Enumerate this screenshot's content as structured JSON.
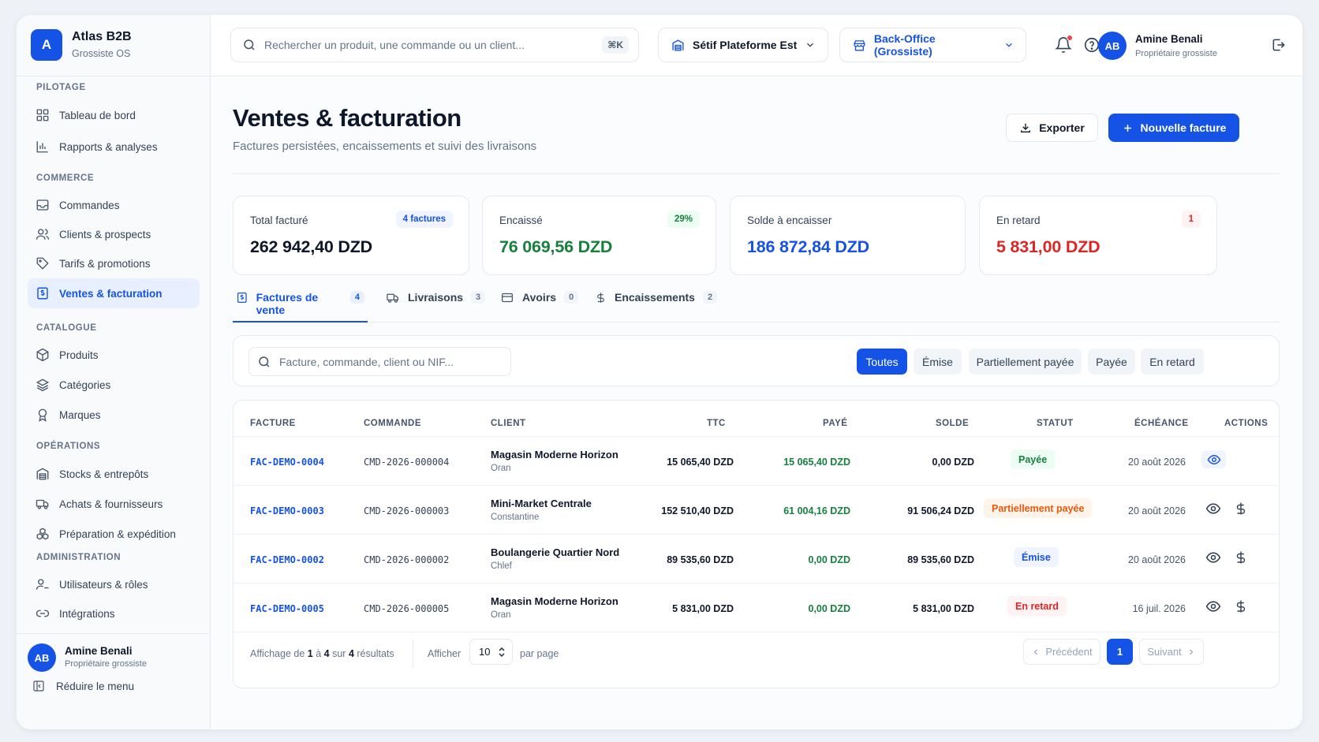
{
  "brand": {
    "logo_letter": "A",
    "name": "Atlas B2B",
    "subtitle": "Grossiste OS"
  },
  "sidebar": {
    "sections": {
      "pilotage": "PILOTAGE",
      "commerce": "COMMERCE",
      "catalogue": "CATALOGUE",
      "operations": "OPÉRATIONS",
      "administration": "ADMINISTRATION"
    },
    "items": [
      {
        "label": "Tableau de bord",
        "icon": "grid-icon"
      },
      {
        "label": "Rapports & analyses",
        "icon": "bar-chart-icon"
      },
      {
        "label": "Commandes",
        "icon": "inbox-icon"
      },
      {
        "label": "Clients & prospects",
        "icon": "users-icon"
      },
      {
        "label": "Tarifs & promotions",
        "icon": "tag-icon"
      },
      {
        "label": "Ventes & facturation",
        "icon": "receipt-icon",
        "active": true
      },
      {
        "label": "Produits",
        "icon": "box-icon"
      },
      {
        "label": "Catégories",
        "icon": "layers-icon"
      },
      {
        "label": "Marques",
        "icon": "award-icon"
      },
      {
        "label": "Stocks & entrepôts",
        "icon": "warehouse-icon"
      },
      {
        "label": "Achats & fournisseurs",
        "icon": "truck-icon"
      },
      {
        "label": "Préparation & expédition",
        "icon": "boxes-icon"
      },
      {
        "label": "Utilisateurs & rôles",
        "icon": "user-cog-icon"
      },
      {
        "label": "Intégrations",
        "icon": "link-icon"
      }
    ],
    "user": {
      "initials": "AB",
      "name": "Amine Benali",
      "role": "Propriétaire grossiste"
    },
    "collapse_label": "Réduire le menu"
  },
  "header": {
    "search_placeholder": "Rechercher un produit, une commande ou un client...",
    "search_shortcut": "⌘K",
    "site": "Sétif Plateforme Est",
    "mode": "Back-Office (Grossiste)",
    "user": {
      "initials": "AB",
      "name": "Amine Benali",
      "role": "Propriétaire grossiste"
    }
  },
  "page": {
    "title": "Ventes & facturation",
    "subtitle": "Factures persistées, encaissements et suivi des livraisons",
    "export_label": "Exporter",
    "new_invoice_label": "Nouvelle facture"
  },
  "kpis": [
    {
      "label": "Total facturé",
      "value": "262 942,40 DZD",
      "badge": "4 factures",
      "value_color": "#0f172a"
    },
    {
      "label": "Encaissé",
      "value": "76 069,56 DZD",
      "badge": "29%",
      "value_color": "#16803c"
    },
    {
      "label": "Solde à encaisser",
      "value": "186 872,84 DZD",
      "badge": "",
      "value_color": "#1553e6"
    },
    {
      "label": "En retard",
      "value": "5 831,00 DZD",
      "badge": "1",
      "value_color": "#dc2626"
    }
  ],
  "tabs": [
    {
      "label": "Factures de vente",
      "count": "4",
      "active": true
    },
    {
      "label": "Livraisons",
      "count": "3"
    },
    {
      "label": "Avoirs",
      "count": "0"
    },
    {
      "label": "Encaissements",
      "count": "2"
    }
  ],
  "filters": {
    "search_placeholder": "Facture, commande, client ou NIF...",
    "chips": [
      "Toutes",
      "Émise",
      "Partiellement payée",
      "Payée",
      "En retard"
    ],
    "active_chip": "Toutes"
  },
  "table": {
    "columns": [
      "FACTURE",
      "COMMANDE",
      "CLIENT",
      "TTC",
      "PAYÉ",
      "SOLDE",
      "STATUT",
      "ÉCHÉANCE",
      "ACTIONS"
    ],
    "rows": [
      {
        "invoice": "FAC-DEMO-0004",
        "order": "CMD-2026-000004",
        "client": "Magasin Moderne Horizon",
        "city": "Oran",
        "ttc": "15 065,40 DZD",
        "paid": "15 065,40 DZD",
        "balance": "0,00 DZD",
        "status": "Payée",
        "due": "20 août 2026"
      },
      {
        "invoice": "FAC-DEMO-0003",
        "order": "CMD-2026-000003",
        "client": "Mini-Market Centrale",
        "city": "Constantine",
        "ttc": "152 510,40 DZD",
        "paid": "61 004,16 DZD",
        "balance": "91 506,24 DZD",
        "status": "Partiellement payée",
        "due": "20 août 2026"
      },
      {
        "invoice": "FAC-DEMO-0002",
        "order": "CMD-2026-000002",
        "client": "Boulangerie Quartier Nord",
        "city": "Chlef",
        "ttc": "89 535,60 DZD",
        "paid": "0,00 DZD",
        "balance": "89 535,60 DZD",
        "status": "Émise",
        "due": "20 août 2026"
      },
      {
        "invoice": "FAC-DEMO-0005",
        "order": "CMD-2026-000005",
        "client": "Magasin Moderne Horizon",
        "city": "Oran",
        "ttc": "5 831,00 DZD",
        "paid": "0,00 DZD",
        "balance": "5 831,00 DZD",
        "status": "En retard",
        "due": "16 juil. 2026"
      }
    ]
  },
  "footer": {
    "info_prefix": "Affichage de",
    "info_from": "1",
    "info_to_word": "à",
    "info_to": "4",
    "info_of_word": "sur",
    "info_total": "4",
    "info_suffix": "résultats",
    "show_label": "Afficher",
    "page_size": "10",
    "per_page": "par page",
    "prev_label": "Précédent",
    "current_page": "1",
    "next_label": "Suivant"
  },
  "colors": {
    "accent": "#1553e6",
    "success": "#16803c",
    "danger": "#dc2626",
    "warning": "#ea580c"
  }
}
